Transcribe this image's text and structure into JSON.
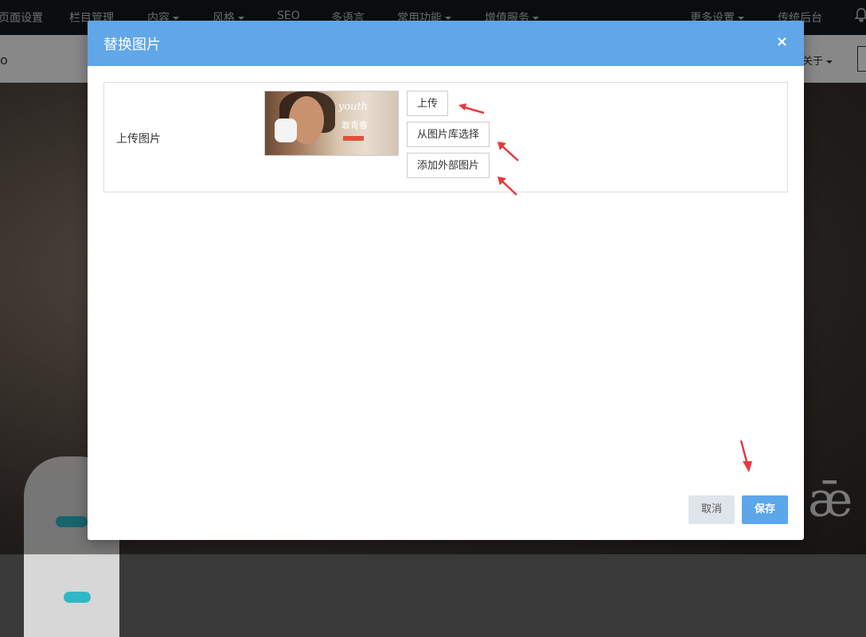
{
  "topnav": {
    "items": [
      {
        "label": "页面设置",
        "caret": false
      },
      {
        "label": "栏目管理",
        "caret": false
      },
      {
        "label": "内容",
        "caret": true
      },
      {
        "label": "风格",
        "caret": true
      },
      {
        "label": "SEO",
        "caret": false
      },
      {
        "label": "多语言",
        "caret": false
      },
      {
        "label": "常用功能",
        "caret": true
      },
      {
        "label": "增值服务",
        "caret": true
      },
      {
        "label": "更多设置",
        "caret": true
      },
      {
        "label": "传统后台",
        "caret": false
      }
    ],
    "bell_icon": "bell-icon"
  },
  "subbar": {
    "left_text": "o",
    "right_text": "关于"
  },
  "hero": {
    "text": "ǣ"
  },
  "modal": {
    "title": "替换图片",
    "close_label": "×",
    "field_label": "上传图片",
    "thumbnail": {
      "line1": "youth",
      "line2": "敢青春"
    },
    "buttons": {
      "upload": "上传",
      "library": "从图片库选择",
      "external": "添加外部图片"
    },
    "footer": {
      "cancel": "取消",
      "save": "保存"
    },
    "annotation_color": "#e8393d"
  }
}
